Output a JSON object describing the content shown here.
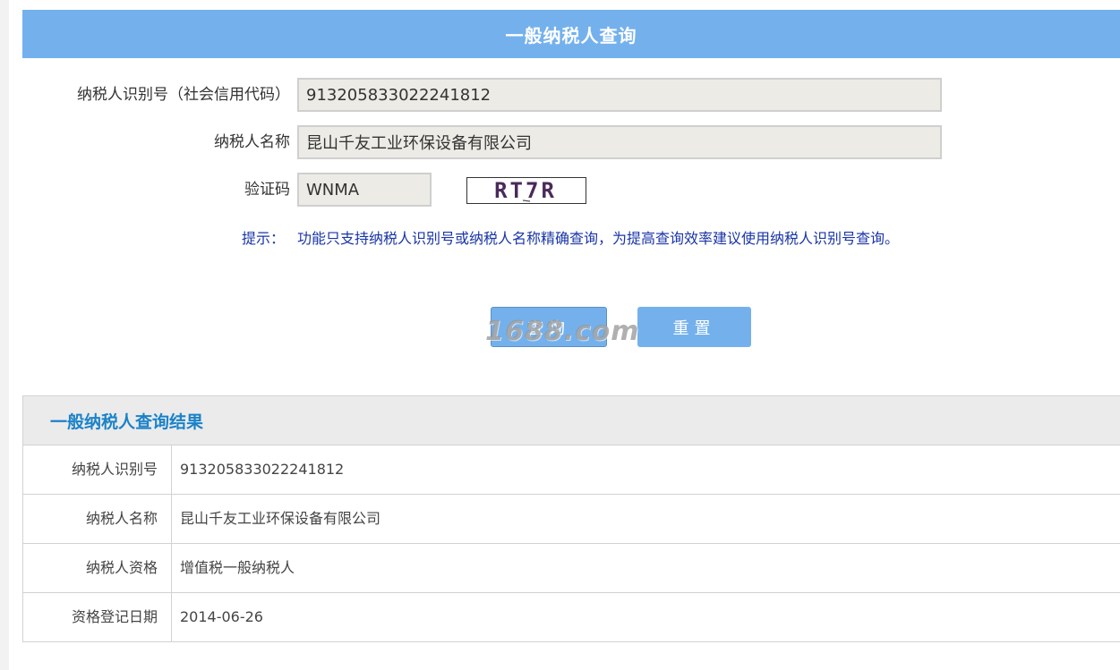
{
  "query": {
    "title": "一般纳税人查询",
    "taxpayer_id_label": "纳税人识别号（社会信用代码）",
    "taxpayer_id_value": "913205833022241812",
    "taxpayer_name_label": "纳税人名称",
    "taxpayer_name_value": "昆山千友工业环保设备有限公司",
    "captcha_label": "验证码",
    "captcha_value": "WNMA",
    "captcha_image_text": "RT7R",
    "hint_label": "提示：",
    "hint_text": "功能只支持纳税人识别号或纳税人名称精确查询，为提高查询效率建议使用纳税人识别号查询。",
    "query_button": "查询",
    "reset_button": "重置"
  },
  "watermark": "1688.com",
  "result": {
    "title": "一般纳税人查询结果",
    "rows": [
      {
        "label": "纳税人识别号",
        "value": "913205833022241812"
      },
      {
        "label": "纳税人名称",
        "value": "昆山千友工业环保设备有限公司"
      },
      {
        "label": "纳税人资格",
        "value": "增值税一般纳税人"
      },
      {
        "label": "资格登记日期",
        "value": "2014-06-26"
      }
    ]
  },
  "colors": {
    "header_bg": "#74b1ec",
    "result_title": "#1b82c8",
    "hint": "#1a35a8"
  }
}
